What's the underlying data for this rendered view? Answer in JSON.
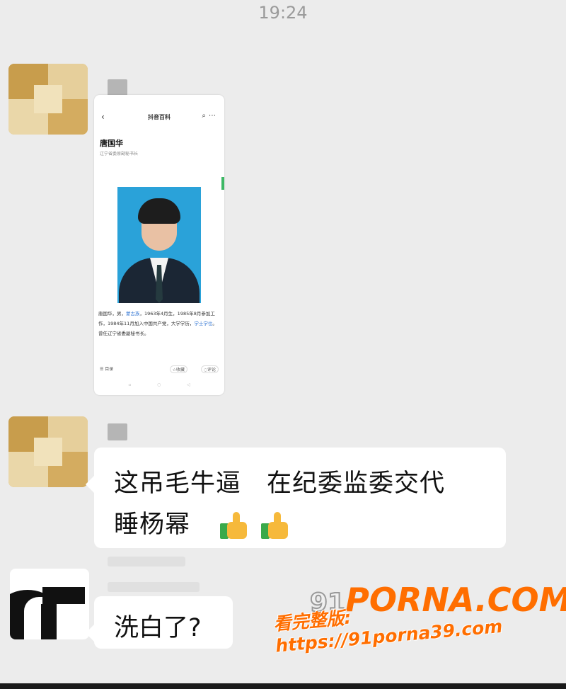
{
  "status": {
    "time": "19:24"
  },
  "shared_screenshot": {
    "app_title": "抖音百科",
    "person_name": "唐国华",
    "person_subtitle": "辽宁省委原副秘书长",
    "bio_part1": "唐国华，男，",
    "bio_link1": "蒙古族",
    "bio_part2": "，1963年4月生，1985年8月参加工作，1984年11月加入中国共产党，大学学历，",
    "bio_link2": "学士学位",
    "bio_part3": "。曾任辽宁省委副秘书长。",
    "footer_directory": "目录",
    "footer_favorite": "收藏",
    "footer_comment": "评论"
  },
  "messages": [
    {
      "line1": "这吊毛牛逼　在纪委监委交代",
      "line2": "睡杨幂"
    },
    {
      "text": "洗白了?"
    }
  ],
  "watermark": {
    "logo_num": "91",
    "logo_text": "PORNA.COM",
    "url_line": "看完整版: https://91porna39.com"
  },
  "colors": {
    "bubble": "#ffffff",
    "background": "#ececec",
    "watermark": "#ff6e00",
    "link": "#3a7bd5"
  }
}
